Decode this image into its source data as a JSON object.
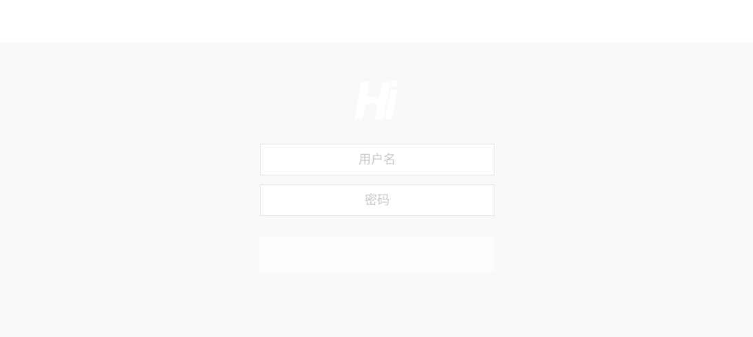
{
  "logo": {
    "icon": "hi-logo-icon"
  },
  "form": {
    "username_placeholder": "用户名",
    "password_placeholder": "密码",
    "submit_label": ""
  },
  "colors": {
    "page_background": "#f9f9f9",
    "header_background": "#ffffff",
    "field_border": "#e3e3e3",
    "placeholder": "#c8c8c8"
  }
}
